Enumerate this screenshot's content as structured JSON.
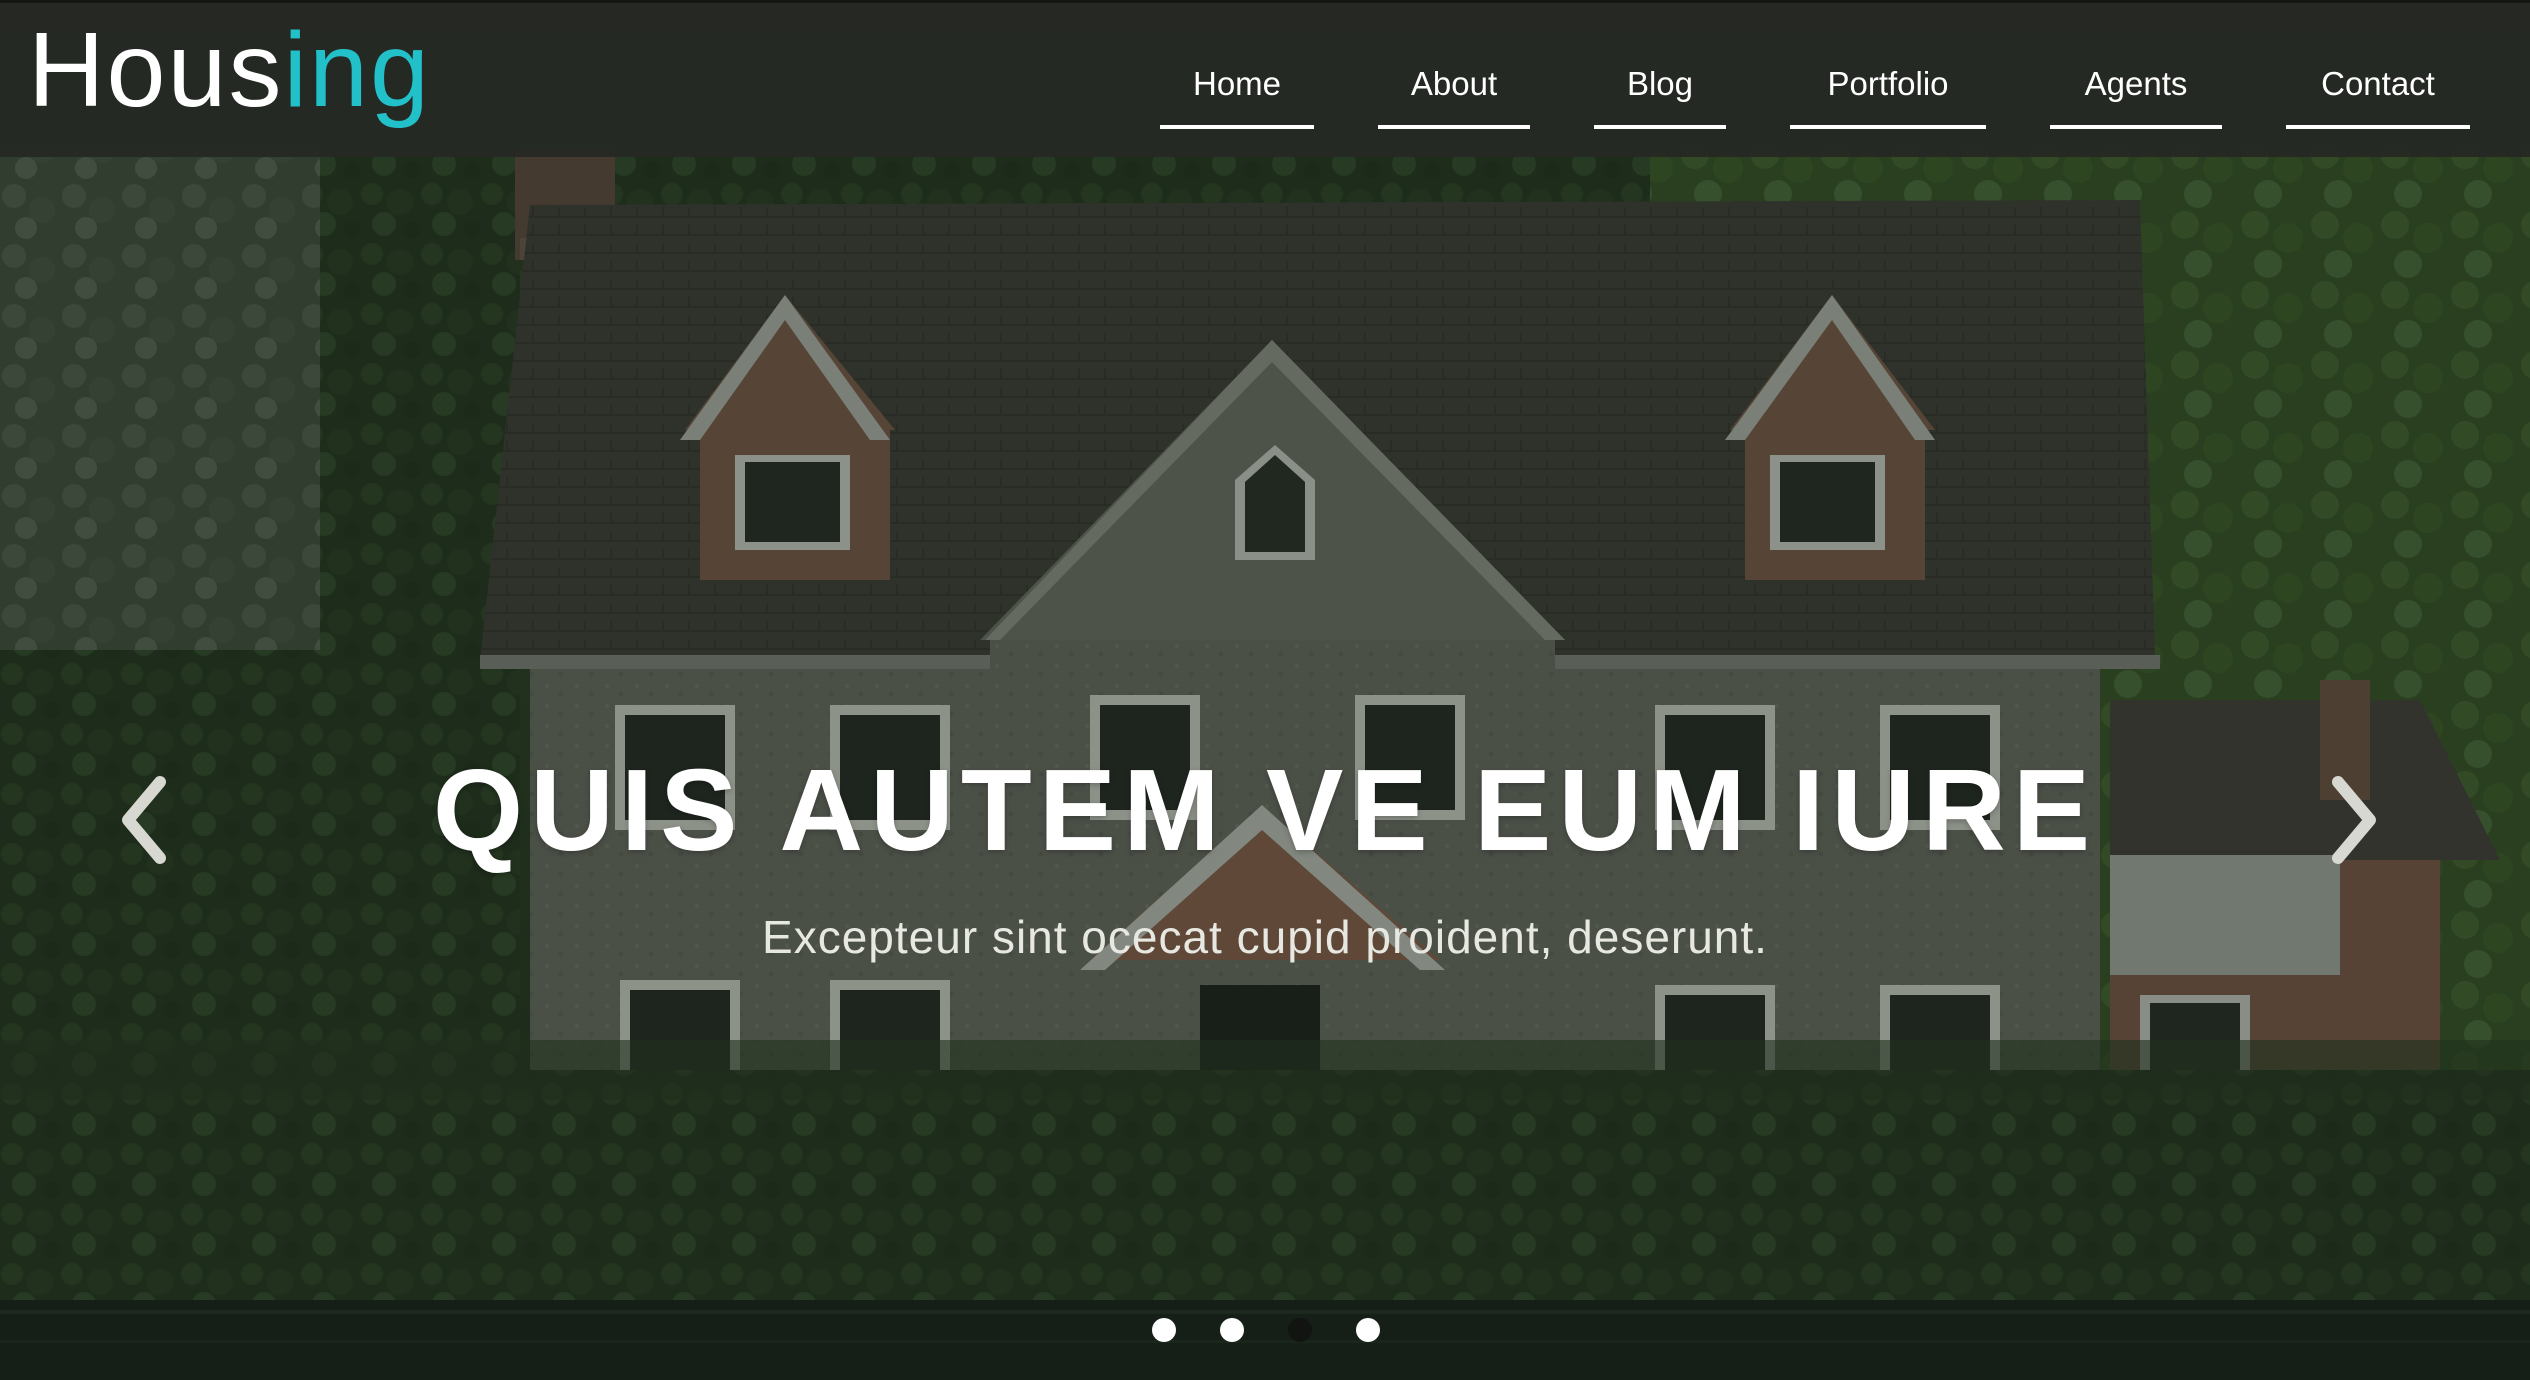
{
  "brand": {
    "logo_primary": "Hous",
    "logo_accent": "ing",
    "accent_color": "#22c1c9"
  },
  "nav": {
    "items": [
      {
        "label": "Home"
      },
      {
        "label": "About"
      },
      {
        "label": "Blog"
      },
      {
        "label": "Portfolio"
      },
      {
        "label": "Agents"
      },
      {
        "label": "Contact"
      }
    ]
  },
  "hero": {
    "title": "QUIS AUTEM VE EUM IURE",
    "subtitle": "Excepteur sint ocecat cupid proident, deserunt.",
    "prev_icon": "chevron-left-icon",
    "next_icon": "chevron-right-icon"
  },
  "carousel": {
    "slide_count": 4,
    "active_index": 3
  }
}
